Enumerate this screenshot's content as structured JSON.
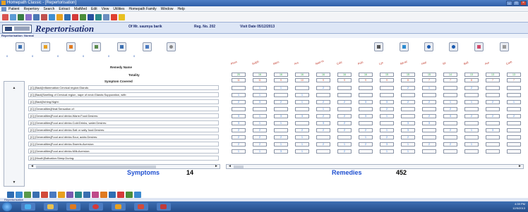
{
  "window": {
    "title": "Homepath Classic - [Repertorisation]"
  },
  "menu": [
    "Patient",
    "Repertory",
    "Search",
    "Extract",
    "MatMed",
    "Edit",
    "View",
    "Utilities",
    "Homepath Family",
    "Window",
    "Help"
  ],
  "header": {
    "title": "Repertorisation",
    "patient": "Of Mr.  saumya  barik",
    "reg": "Reg. No.  202",
    "visit": "Visit Date  05/12/2013",
    "mode": "Repertorisation: Normal"
  },
  "left_counts": [
    "0",
    "0",
    "0",
    "0",
    "0",
    "0"
  ],
  "labels": {
    "remedy_name": "Remedy Name",
    "totality": "Totality",
    "symptom_covered": "Symptom Covered"
  },
  "rubrics": [
    "[C] [Back]Inflammation:Cervical region:Glands:",
    "[C] [Back]Swelling of Cervical region, nape of neck:Glands:Suppuration, with:",
    "[C] [Back]Itching:Night:",
    "[C] [Generalities]Heat:Sensation of:",
    "[C] [Generalities]Food and drinks:Warm:Food:Desires:",
    "[C] [Generalities]Food and drinks:Cold:Drinks, water:Desires:",
    "[C] [Generalities]Food and drinks:Salt or salty food:Desires:",
    "[C] [Generalities]Food and drinks:Sour, acids:Desires:",
    "[C] [Generalities]Food and drinks:Sweets:Aversion:",
    "[C] [Generalities]Food and drinks:Milk:Aversion:",
    "[C] [Mouth]Salivation:Sleep:During:"
  ],
  "remedies": [
    "Phos",
    "Sulph",
    "Merc",
    "Ars",
    "Natr-m",
    "Calc",
    "Puls",
    "Lyc",
    "Nit-ac",
    "Hep",
    "Sil",
    "Bell",
    "Aur",
    "Carb"
  ],
  "totality": [
    "20",
    "16",
    "16",
    "16",
    "16",
    "16",
    "16",
    "15",
    "15",
    "15",
    "14",
    "13",
    "13",
    "13"
  ],
  "symptom_covered": [
    "11",
    "11",
    "9",
    "10",
    "9",
    "9",
    "9",
    "9",
    "8",
    "7",
    "7",
    "8",
    "7",
    "7"
  ],
  "grid": [
    [
      "",
      "1",
      "1",
      "",
      "2",
      "",
      "",
      "",
      "2",
      "1",
      "",
      "2",
      "",
      ""
    ],
    [
      "1",
      "1",
      "",
      "1",
      "",
      "",
      "",
      "",
      "",
      "",
      "",
      "",
      "",
      ""
    ],
    [
      "2",
      "3",
      "2",
      "1",
      "2",
      "2",
      "3",
      "3",
      "2",
      "2",
      "1",
      "1",
      "2",
      "1"
    ],
    [
      "",
      "",
      "",
      "",
      "1",
      "",
      "",
      "2",
      "",
      "",
      "2",
      "",
      "",
      ""
    ],
    [
      "3",
      "1",
      "3",
      "3",
      "2",
      "2",
      "3",
      "1",
      "",
      "2",
      "3",
      "2",
      "2",
      "2"
    ],
    [
      "3",
      "1",
      "1",
      "",
      "3",
      "2",
      "",
      "",
      "3",
      "3",
      "",
      "",
      "",
      ""
    ],
    [
      "2",
      "2",
      "",
      "2",
      "2",
      "2",
      "2",
      "1",
      "3",
      "",
      "2",
      "1",
      "3",
      ""
    ],
    [
      "2",
      "2",
      "2",
      "1",
      "",
      "",
      "1",
      "2",
      "2",
      "",
      "",
      "",
      "",
      ""
    ],
    [
      "2",
      "2",
      "1",
      "1",
      "2",
      "1",
      "2",
      "3",
      "1",
      "2",
      "2",
      "1",
      "",
      ""
    ],
    [
      "1",
      "1",
      "3",
      "1",
      "",
      "2",
      "",
      "1",
      "1",
      "",
      "",
      "",
      "",
      ""
    ]
  ],
  "footer": {
    "symptoms_label": "Symptoms",
    "symptoms_count": "14",
    "remedies_label": "Remedies",
    "remedies_count": "452"
  },
  "taskbar": {
    "label": "Repertorisation",
    "time": "4:39 PM",
    "date": "12/5/2013"
  },
  "colors": {
    "accent": "#1c2b6e",
    "remedy_name": "#c0392b",
    "counts": "#2a5ab8"
  }
}
